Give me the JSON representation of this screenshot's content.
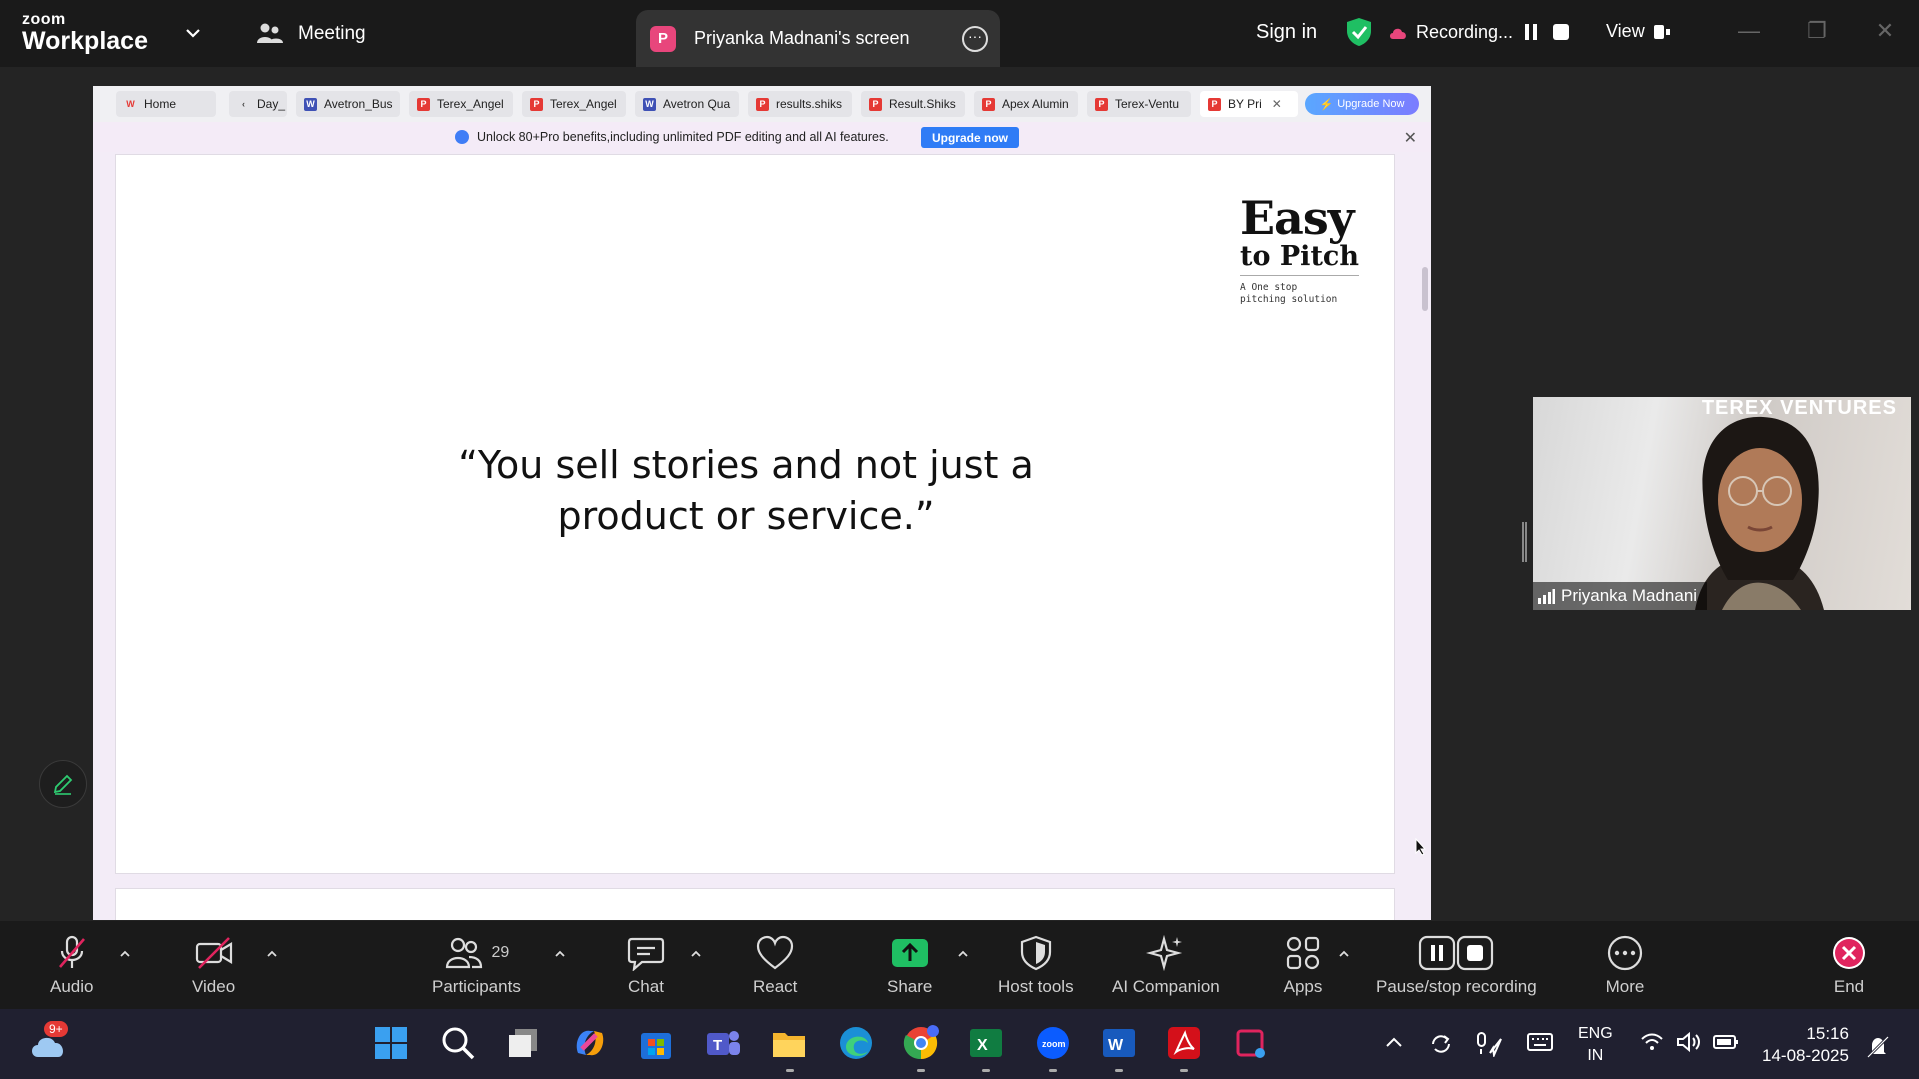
{
  "titlebar": {
    "brand_small": "zoom",
    "brand_large": "Workplace",
    "meeting_label": "Meeting",
    "share_badge": "P",
    "share_title": "Priyanka Madnani's screen",
    "signin": "Sign in",
    "recording": "Recording...",
    "view": "View"
  },
  "browser": {
    "tabs": [
      {
        "label": "Home",
        "icon_color": "#e53935",
        "icon_char": "W"
      },
      {
        "label": "Day_",
        "icon_color": "",
        "icon_char": ""
      },
      {
        "label": "Avetron_Bus",
        "icon_color": "#3f51b5",
        "icon_char": "W"
      },
      {
        "label": "Terex_Angel",
        "icon_color": "#e53935",
        "icon_char": "P"
      },
      {
        "label": "Terex_Angel",
        "icon_color": "#e53935",
        "icon_char": "P"
      },
      {
        "label": "Avetron Qua",
        "icon_color": "#3f51b5",
        "icon_char": "W"
      },
      {
        "label": "results.shiks",
        "icon_color": "#e53935",
        "icon_char": "P"
      },
      {
        "label": "Result.Shiks",
        "icon_color": "#e53935",
        "icon_char": "P"
      },
      {
        "label": "Apex Alumin",
        "icon_color": "#e53935",
        "icon_char": "P"
      },
      {
        "label": "Terex-Ventu",
        "icon_color": "#e53935",
        "icon_char": "P"
      },
      {
        "label": "BY Pri",
        "icon_color": "#e53935",
        "icon_char": "P"
      }
    ],
    "upgrade_pill": "Upgrade Now",
    "banner_text": "Unlock 80+Pro benefits,including unlimited PDF editing and all AI features.",
    "banner_button": "Upgrade now"
  },
  "slide": {
    "logo_title": "Easy",
    "logo_subtitle": "to Pitch",
    "logo_tagline_1": "A One stop",
    "logo_tagline_2": "pitching solution",
    "quote_line_1": "“You sell stories and not just a",
    "quote_line_2": "product or service.”"
  },
  "video": {
    "brand": "TEREX VENTURES",
    "participant_name": "Priyanka Madnani"
  },
  "toolbar": {
    "audio": "Audio",
    "video": "Video",
    "participants": "Participants",
    "participants_count": "29",
    "chat": "Chat",
    "react": "React",
    "share": "Share",
    "host_tools": "Host tools",
    "ai_companion": "AI Companion",
    "apps": "Apps",
    "pause_stop": "Pause/stop recording",
    "more": "More",
    "end": "End",
    "share_color": "#1fbf63",
    "end_color": "#e0245e"
  },
  "taskbar": {
    "weather_badge": "9+",
    "lang_1": "ENG",
    "lang_2": "IN",
    "time": "15:16",
    "date": "14-08-2025",
    "icons": [
      "windows-start-icon",
      "search-icon",
      "task-view-icon",
      "copilot-icon",
      "store-icon",
      "teams-icon",
      "file-explorer-icon",
      "edge-icon",
      "chrome-icon",
      "excel-icon",
      "zoom-icon",
      "word-icon",
      "acrobat-icon",
      "snipping-tool-icon"
    ]
  }
}
